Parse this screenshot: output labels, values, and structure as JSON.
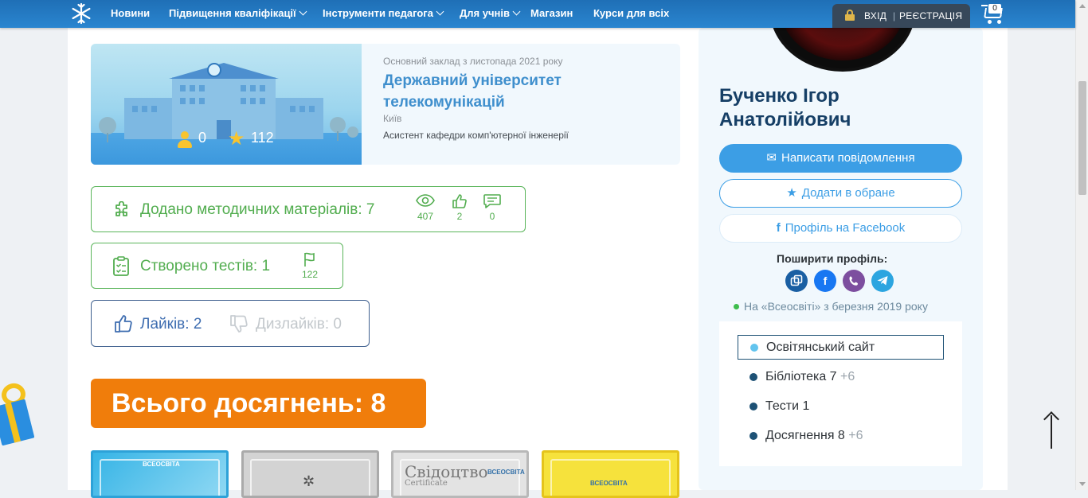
{
  "navbar": {
    "items": [
      {
        "label": "Новини"
      },
      {
        "label": "Підвищення кваліфікації"
      },
      {
        "label": "Інструменти педагога"
      },
      {
        "label": "Для учнів"
      },
      {
        "label": "Магазин"
      },
      {
        "label": "Курси для всіх"
      }
    ],
    "login": {
      "label": "ВХІД",
      "separator": "|",
      "register": "РЕЄСТРАЦІЯ"
    },
    "cart_count": "0"
  },
  "institution": {
    "since": "Основний заклад з листопада 2021 року",
    "name": "Державний університет телекомунікацій",
    "city": "Київ",
    "position": "Асистент кафедри комп'ютерної інженерії",
    "users_count": "0",
    "stars_count": "112"
  },
  "stats": {
    "materials": {
      "label": "Додано методичних матеріалів: 7",
      "views": "407",
      "likes": "2",
      "comments": "0"
    },
    "tests": {
      "label": "Створено тестів: 1",
      "flags": "122"
    },
    "likes": {
      "likes_label": "Лайків: 2",
      "dislikes_label": "Дизлайків: 0"
    }
  },
  "achievements": {
    "total_label": "Всього досягнень: 8",
    "cert_title": "Свідоцтво",
    "cert_sub": "Certificate",
    "cert_logo": "ВСЕОСВІТА"
  },
  "profile": {
    "name": "Бученко Ігор Анатолійович",
    "message_button": "Написати повідомлення",
    "favorite_button": "Додати в обране",
    "facebook_button": "Профіль на Facebook",
    "share_title": "Поширити профіль:",
    "member_since": "На «Всеосвіті» з березня 2019 року",
    "menu": [
      {
        "label": "Освітянський сайт",
        "extra": ""
      },
      {
        "label": "Бібліотека 7",
        "extra": "+6"
      },
      {
        "label": "Тести 1",
        "extra": ""
      },
      {
        "label": "Досягнення 8",
        "extra": "+6"
      }
    ]
  },
  "colors": {
    "nav_bg": "#2a86d0",
    "green": "#52ad4f",
    "orange": "#f07d0b",
    "primary_blue": "#3c9ee5",
    "dark_blue": "#163f66"
  }
}
